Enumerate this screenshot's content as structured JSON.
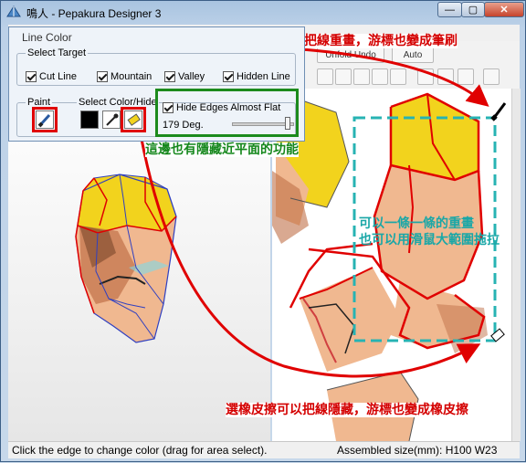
{
  "window": {
    "title": "鳴人 - Pepakura Designer 3",
    "min_label": "—",
    "max_label": "▢",
    "close_label": "✕"
  },
  "toolbar": {
    "unfold_undo_label": "Unfold Undo",
    "auto_label": "Auto"
  },
  "dialog": {
    "title": "Line Color",
    "select_target_label": "Select Target",
    "targets": [
      {
        "label": "Cut Line",
        "checked": true
      },
      {
        "label": "Mountain",
        "checked": true
      },
      {
        "label": "Valley",
        "checked": true
      },
      {
        "label": "Hidden Line",
        "checked": true
      }
    ],
    "paint_label": "Paint",
    "select_color_label": "Select Color/Hide",
    "hide_edges_label": "Hide Edges Almost Flat",
    "hide_edges_checked": true,
    "angle_label": "179 Deg.",
    "angle_value_fraction": 0.98
  },
  "annotations": {
    "brush": "選筆刷可以把線重畫，游標也變成筆刷",
    "hide_flat": "這邊也有隱藏近平面的功能",
    "redraw_line1": "可以一條一條的重畫",
    "redraw_line2": "也可以用滑鼠大範圍拖拉",
    "eraser": "選橡皮擦可以把線隱藏，游標也變成橡皮擦"
  },
  "status": {
    "left": "Click the edge to change color (drag for area select).",
    "right": "Assembled size(mm): H100 W23"
  },
  "colors": {
    "annotation_red": "#d40000",
    "highlight_red": "#e00000",
    "highlight_green": "#1c8a1c",
    "selection_cyan": "#27b3b3",
    "hair_yellow": "#f2d31d",
    "skin": "#f0b890"
  }
}
